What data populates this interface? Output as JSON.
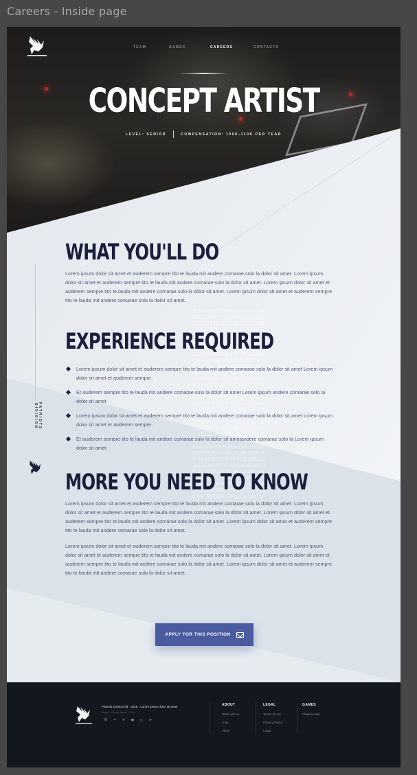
{
  "canvas_title": "Careers - Inside page",
  "nav": {
    "items": [
      {
        "label": "TEAM",
        "active": false
      },
      {
        "label": "GAMES",
        "active": false
      },
      {
        "label": "CAREERS",
        "active": true
      },
      {
        "label": "CONTACTS",
        "active": false
      }
    ]
  },
  "hero": {
    "title": "CONCEPT ARTIST",
    "level": "LEVEL: SENIOR",
    "compensation": "COMPENSATION: 100K-110K PER YEAR"
  },
  "rail": {
    "text": "PATRIOTS DIVISION"
  },
  "sections": {
    "what_title": "WHAT YOU'LL DO",
    "what_text": "Lorem ipsum dolor sit amet et auderem sempre tito te lauda mit andere comarae solo la dolor sit amet. Lorem ipsum dolor sit amet et auderem sempre tito te lauda mit andere comarae solo la dolor sit amet. Lorem ipsum dolor sit amet et auderem sempre tito te lauda mit andere comarae solo la dolor sit amet. Lorem ipsum dolor sit amet et auderem sempre tito te lauda mit andere comarae solo la dolor sit amet.",
    "exp_title": "EXPERIENCE REQUIRED",
    "exp_items": [
      "Lorem ipsum dolor sit amet et auderem sempre tito te lauda mit andere comarae solo la dolor sit amet Lorem ipsum dolor sit amet et auderem sempre.",
      "Et auderem sempre tito te lauda mit andere comarae solo la dolor sit amet Lorem ipsum andere comarae solo la dolor sit amet",
      "Lorem ipsum dolor sit amet et auderem sempre tito te lauda mit andere comarae solo la dolor sit amet Lorem ipsum dolor sit amet et auderem sempre.",
      "Et auderem sempre tito te lauda mit andere comarae solo la dolor sit ametandere comarae solo la Lorem ipsum dolor sit amet"
    ],
    "more_title": "MORE YOU NEED TO KNOW",
    "more_text_1": "Lorem ipsum dolor sit amet et auderem sempre tito te lauda mit andere comarae solo la dolor sit amet. Lorem ipsum dolor sit amet et auderem sempre tito te lauda mit andere comarae solo la dolor sit amet. Lorem ipsum dolor sit amet et auderem sempre tito te lauda mit andere comarae solo la dolor sit amet. Lorem ipsum dolor sit amet et auderem sempre tito te lauda mit andere comarae solo la dolor sit amet.",
    "more_text_2": "Lorem ipsum dolor sit amet et auderem sempre tito te lauda mit andere comarae solo la dolor sit amet. Lorem ipsum dolor sit amet et auderem sempre tito te lauda mit andere comarae solo la dolor sit amet. Lorem ipsum dolor sit amet et auderem sempre tito te lauda mit andere comarae solo la dolor sit amet. Lorem ipsum dolor sit amet et auderem sempre tito te lauda mit andere comarae solo la dolor sit amet."
  },
  "apply_button": {
    "label": "APPLY FOR THIS POSITION",
    "icon": "mail-icon"
  },
  "footer": {
    "copyright": "Patriots Division ltd - 2025 - Lorem ipsum dolor sit amet",
    "subline": "Brand - Game Name - 20xx",
    "social_icons": [
      "medium-icon",
      "twitter-icon",
      "reddit-icon",
      "discord-icon",
      "instagram-icon",
      "telegram-icon"
    ],
    "columns": [
      {
        "title": "ABOUT",
        "links": [
          "Work with us",
          "Jobs",
          "Vison"
        ]
      },
      {
        "title": "LEGAL",
        "links": [
          "Terms of use",
          "Privacy Policy",
          "Legal"
        ]
      },
      {
        "title": "GAMES",
        "links": [
          "Shadow War"
        ]
      }
    ]
  },
  "colors": {
    "navy": "#1b1f3b",
    "button": "#4a5b9f",
    "footer_bg": "#12181d",
    "page_bg": "#e9edf1"
  }
}
